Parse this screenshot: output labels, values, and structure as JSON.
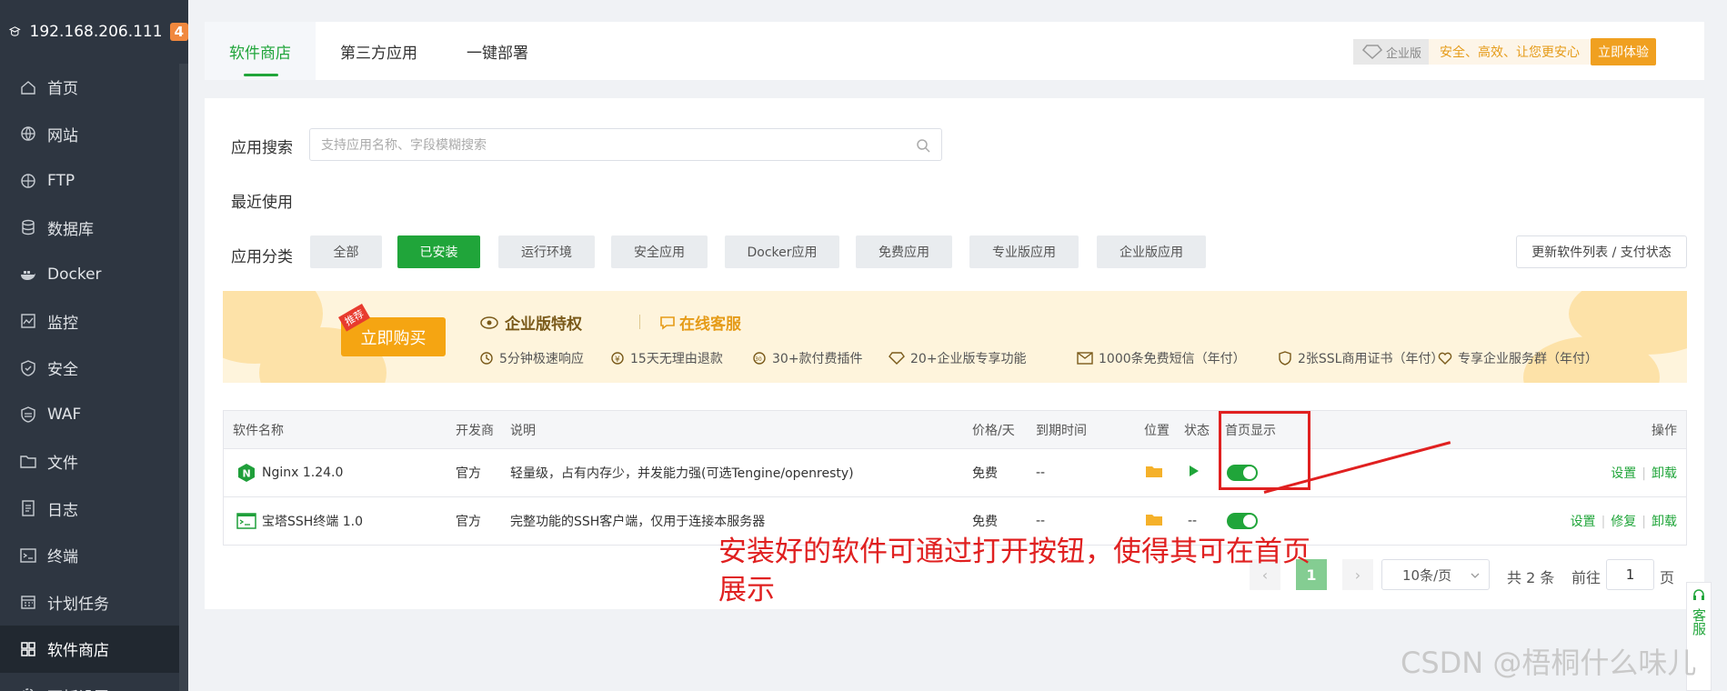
{
  "sidebar": {
    "host": "192.168.206.111",
    "badge": "4",
    "items": [
      {
        "label": "首页",
        "icon": "home-icon"
      },
      {
        "label": "网站",
        "icon": "globe-icon"
      },
      {
        "label": "FTP",
        "icon": "ftp-icon"
      },
      {
        "label": "数据库",
        "icon": "database-icon"
      },
      {
        "label": "Docker",
        "icon": "docker-icon"
      },
      {
        "label": "监控",
        "icon": "monitor-icon"
      },
      {
        "label": "安全",
        "icon": "shield-icon"
      },
      {
        "label": "WAF",
        "icon": "waf-icon"
      },
      {
        "label": "文件",
        "icon": "folder-icon"
      },
      {
        "label": "日志",
        "icon": "log-icon"
      },
      {
        "label": "终端",
        "icon": "terminal-icon"
      },
      {
        "label": "计划任务",
        "icon": "calendar-icon"
      },
      {
        "label": "软件商店",
        "icon": "grid-icon"
      },
      {
        "label": "面板设置",
        "icon": "gear-icon"
      }
    ]
  },
  "tabs": [
    "软件商店",
    "第三方应用",
    "一键部署"
  ],
  "enterprise": {
    "tag": "企业版",
    "slogan": "安全、高效、让您更安心",
    "button": "立即体验"
  },
  "search": {
    "label": "应用搜索",
    "placeholder": "支持应用名称、字段模糊搜索"
  },
  "recent_label": "最近使用",
  "category_label": "应用分类",
  "categories": [
    "全部",
    "已安装",
    "运行环境",
    "安全应用",
    "Docker应用",
    "免费应用",
    "专业版应用",
    "企业版应用"
  ],
  "update_button": "更新软件列表 / 支付状态",
  "banner": {
    "tag": "推荐",
    "buy": "立即购买",
    "title": "企业版特权",
    "service": "在线客服",
    "features": [
      "5分钟极速响应",
      "15天无理由退款",
      "30+款付费插件",
      "20+企业版专享功能",
      "1000条免费短信（年付）",
      "2张SSL商用证书（年付）",
      "专享企业服务群（年付）"
    ]
  },
  "table": {
    "headers": [
      "软件名称",
      "开发商",
      "说明",
      "价格/天",
      "到期时间",
      "位置",
      "状态",
      "首页显示",
      "操作"
    ],
    "rows": [
      {
        "name": "Nginx 1.24.0",
        "vendor": "官方",
        "desc": "轻量级，占有内存少，并发能力强(可选Tengine/openresty)",
        "price": "免费",
        "expire": "--",
        "status": "running",
        "ops": [
          "设置",
          "卸载"
        ]
      },
      {
        "name": "宝塔SSH终端 1.0",
        "vendor": "官方",
        "desc": "完整功能的SSH客户端，仅用于连接本服务器",
        "price": "免费",
        "expire": "--",
        "status": "--",
        "ops": [
          "设置",
          "修复",
          "卸载"
        ]
      }
    ]
  },
  "annotation": "安装好的软件可通过打开按钮，使得其可在首页展示",
  "pager": {
    "current": "1",
    "page_size": "10条/页",
    "total": "共 2 条",
    "goto": "前往",
    "goto_value": "1",
    "page_unit": "页"
  },
  "kefu": "客服",
  "watermark": "CSDN @梧桐什么味儿",
  "colors": {
    "accent": "#20a53a",
    "sidebar": "#2e3641",
    "annotation": "#e02020"
  }
}
